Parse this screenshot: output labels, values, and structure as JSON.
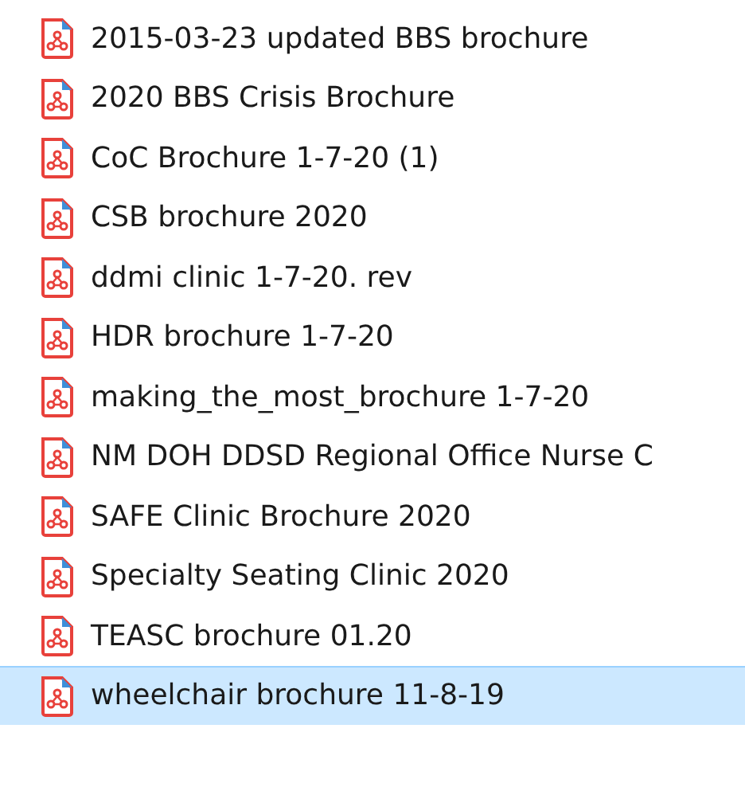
{
  "files": [
    {
      "name": "2015-03-23 updated BBS brochure",
      "selected": false
    },
    {
      "name": "2020 BBS Crisis Brochure",
      "selected": false
    },
    {
      "name": "CoC Brochure 1-7-20 (1)",
      "selected": false
    },
    {
      "name": "CSB brochure 2020",
      "selected": false
    },
    {
      "name": "ddmi clinic 1-7-20. rev",
      "selected": false
    },
    {
      "name": "HDR brochure 1-7-20",
      "selected": false
    },
    {
      "name": "making_the_most_brochure 1-7-20",
      "selected": false
    },
    {
      "name": "NM DOH DDSD Regional Office Nurse C",
      "selected": false
    },
    {
      "name": "SAFE Clinic Brochure 2020",
      "selected": false
    },
    {
      "name": "Specialty Seating Clinic 2020",
      "selected": false
    },
    {
      "name": "TEASC brochure 01.20",
      "selected": false
    },
    {
      "name": "wheelchair brochure 11-8-19",
      "selected": true
    }
  ]
}
